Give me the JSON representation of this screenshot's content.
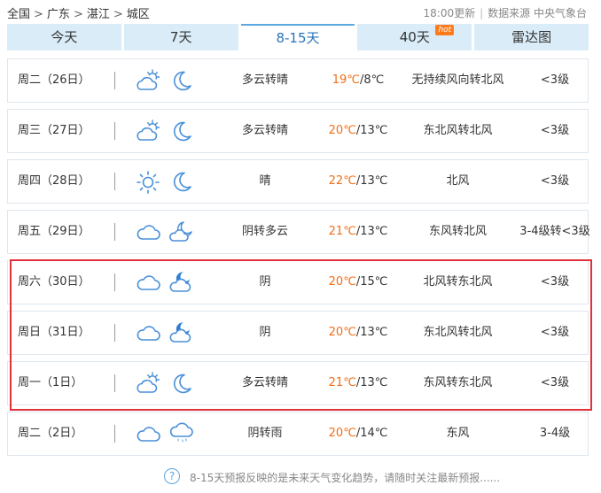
{
  "breadcrumb": [
    "全国",
    "广东",
    "湛江",
    "城区"
  ],
  "breadcrumb_sep": ">",
  "meta": {
    "updated": "18:00更新",
    "source": "数据来源 中央气象台"
  },
  "tabs": [
    {
      "label": "今天",
      "active": false
    },
    {
      "label": "7天",
      "active": false
    },
    {
      "label": "8-15天",
      "active": true
    },
    {
      "label": "40天",
      "active": false,
      "badge": "hot"
    },
    {
      "label": "雷达图",
      "active": false
    }
  ],
  "forecast": [
    {
      "date": "周二（26日）",
      "day_icon": "partly-cloudy-sun-icon",
      "night_icon": "moon-icon",
      "desc": "多云转晴",
      "hi": "19℃",
      "lo": "/8℃",
      "wind": "无持续风向转北风",
      "level": "<3级"
    },
    {
      "date": "周三（27日）",
      "day_icon": "partly-cloudy-sun-icon",
      "night_icon": "moon-icon",
      "desc": "多云转晴",
      "hi": "20℃",
      "lo": "/13℃",
      "wind": "东北风转北风",
      "level": "<3级"
    },
    {
      "date": "周四（28日）",
      "day_icon": "sun-icon",
      "night_icon": "moon-icon",
      "desc": "晴",
      "hi": "22℃",
      "lo": "/13℃",
      "wind": "北风",
      "level": "<3级"
    },
    {
      "date": "周五（29日）",
      "day_icon": "cloud-icon",
      "night_icon": "cloudy-moon-icon",
      "desc": "阴转多云",
      "hi": "21℃",
      "lo": "/13℃",
      "wind": "东风转北风",
      "level": "3-4级转<3级"
    },
    {
      "date": "周六（30日）",
      "day_icon": "cloud-icon",
      "night_icon": "cloud-moon-icon",
      "desc": "阴",
      "hi": "20℃",
      "lo": "/15℃",
      "wind": "北风转东北风",
      "level": "<3级"
    },
    {
      "date": "周日（31日）",
      "day_icon": "cloud-icon",
      "night_icon": "cloud-moon-icon",
      "desc": "阴",
      "hi": "20℃",
      "lo": "/13℃",
      "wind": "东北风转北风",
      "level": "<3级"
    },
    {
      "date": "周一（1日）",
      "day_icon": "partly-cloudy-sun-icon",
      "night_icon": "moon-icon",
      "desc": "多云转晴",
      "hi": "21℃",
      "lo": "/13℃",
      "wind": "东风转东北风",
      "level": "<3级"
    },
    {
      "date": "周二（2日）",
      "day_icon": "cloud-icon",
      "night_icon": "rain-cloud-icon",
      "desc": "阴转雨",
      "hi": "20℃",
      "lo": "/14℃",
      "wind": "东风",
      "level": "3-4级"
    }
  ],
  "footer": {
    "help": "?",
    "note": "8-15天预报反映的是未来天气变化趋势，请随时关注最新预报......"
  },
  "colors": {
    "accent": "#5ba7e0",
    "temp_high": "#f06e16",
    "highlight": "#e0303a"
  }
}
